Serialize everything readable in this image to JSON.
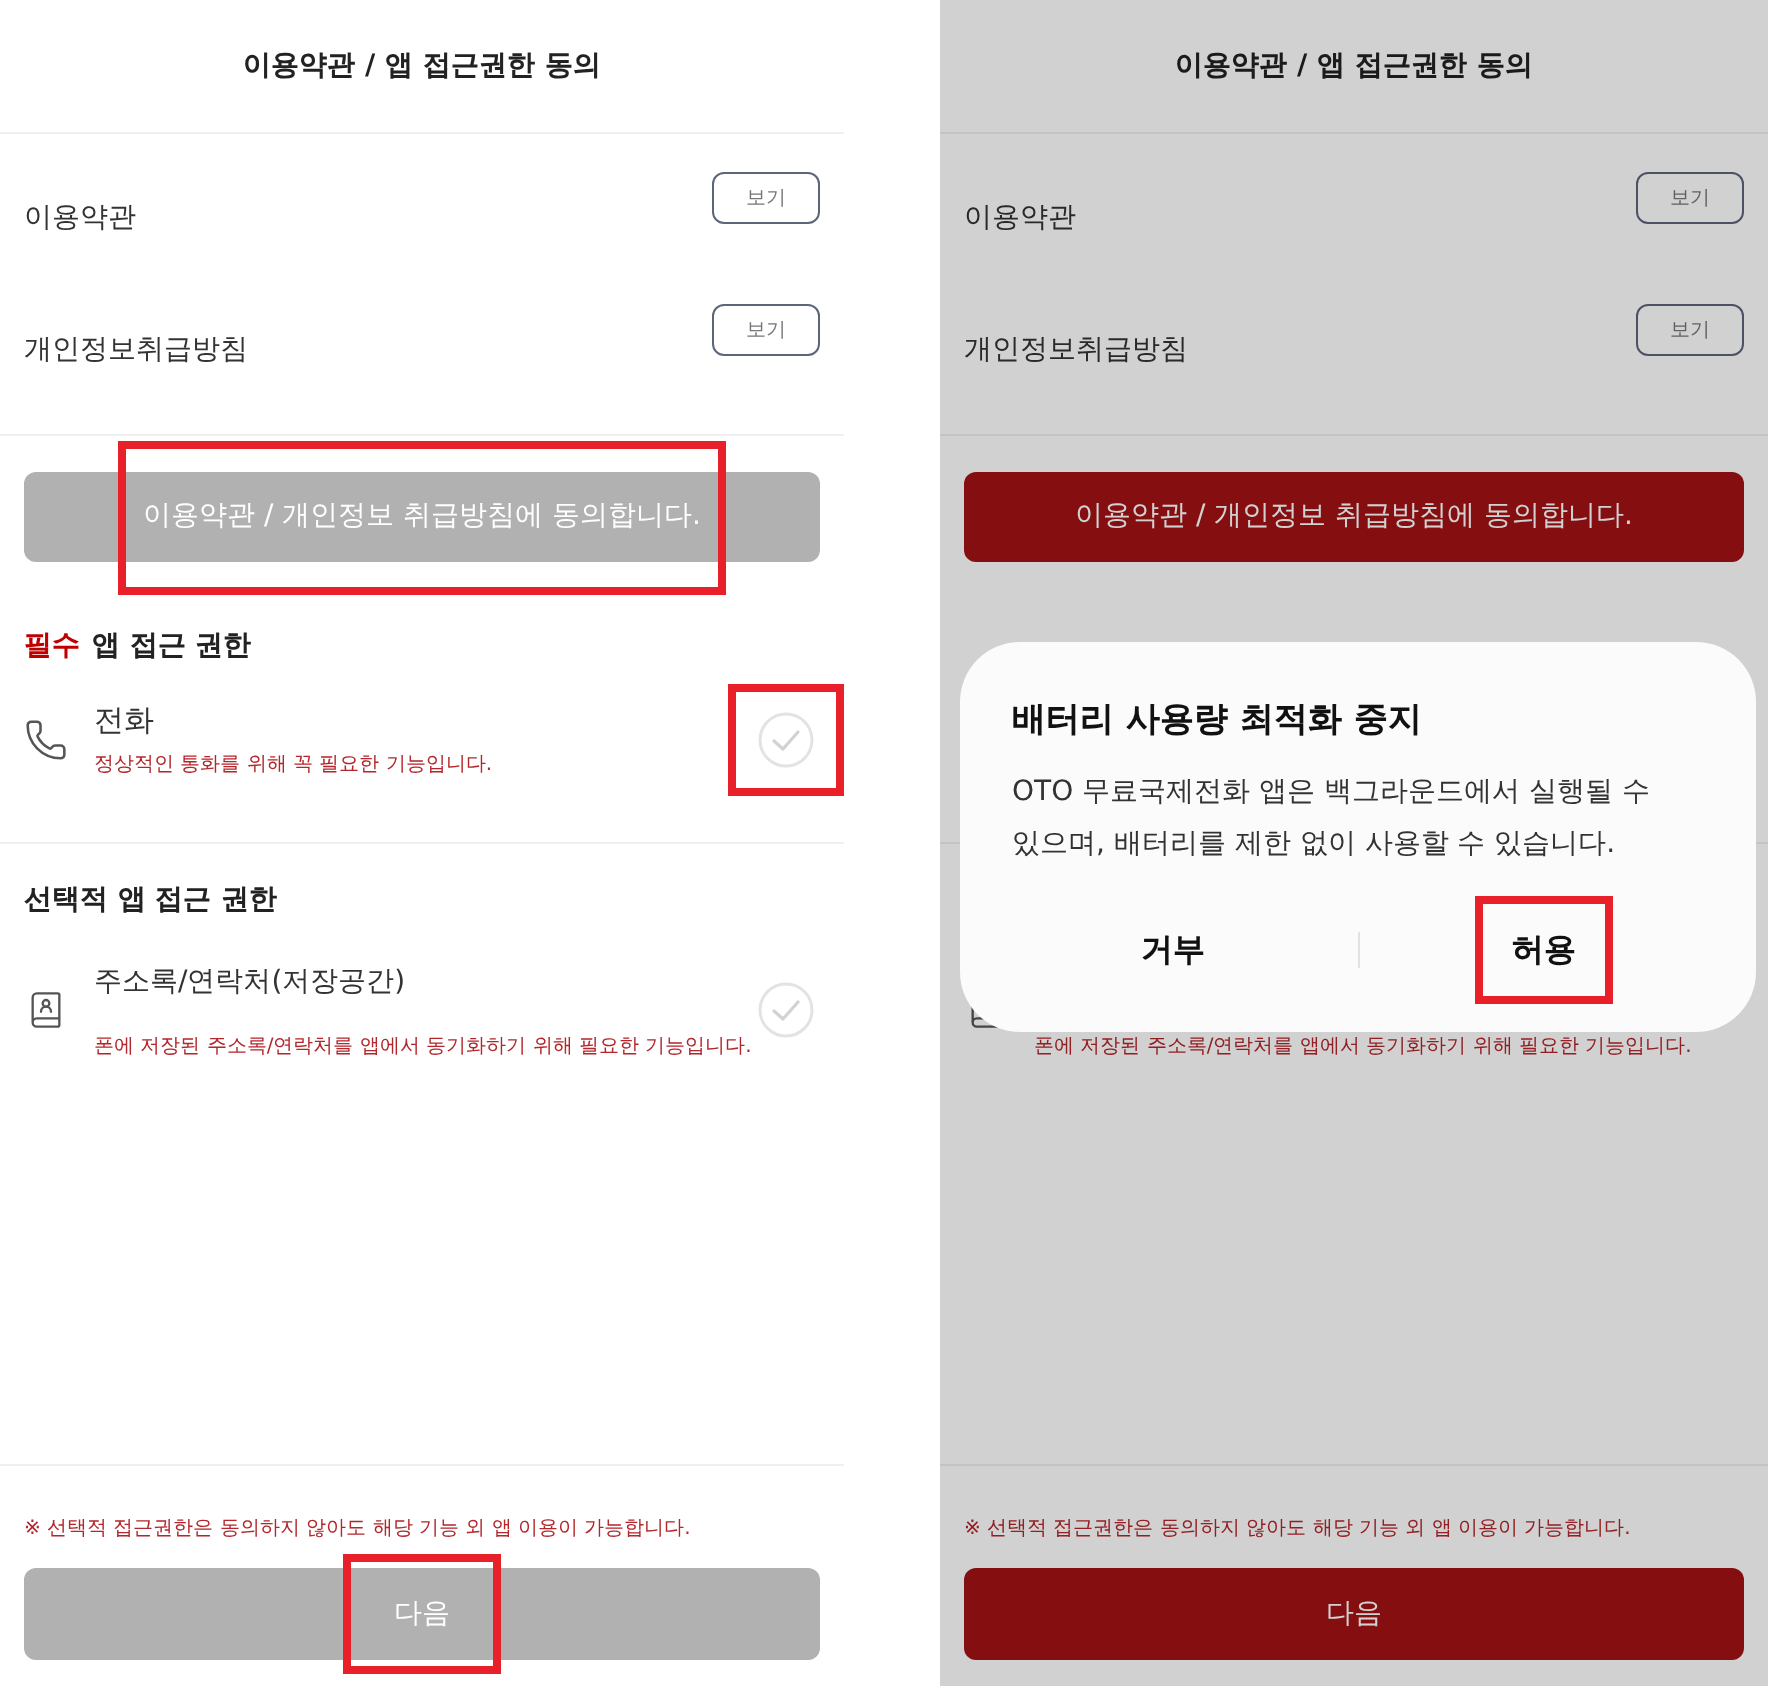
{
  "screens": [
    {
      "title": "이용약관 / 앱 접근권한 동의",
      "documents": [
        {
          "label": "이용약관",
          "view_button": "보기"
        },
        {
          "label": "개인정보취급방침",
          "view_button": "보기"
        }
      ],
      "agree_button": {
        "label": "이용약관 / 개인정보 취급방침에 동의합니다.",
        "enabled": false,
        "highlighted": true
      },
      "required_permissions": {
        "tag": "필수",
        "title": "앱 접근 권한",
        "items": [
          {
            "kind": "phone",
            "name": "전화",
            "description": "정상적인 통화를 위해 꼭 필요한 기능입니다.",
            "checked": false,
            "highlighted": true
          }
        ]
      },
      "optional_permissions": {
        "title": "선택적 앱 접근 권한",
        "items": [
          {
            "kind": "contacts",
            "name": "주소록/연락처(저장공간)",
            "description": "폰에 저장된 주소록/연락처를 앱에서 동기화하기 위해 필요한 기능입니다.",
            "checked": false,
            "highlighted": false
          }
        ]
      },
      "note": "※ 선택적 접근권한은 동의하지 않아도 해당 기능 외 앱 이용이 가능합니다.",
      "next_button": {
        "label": "다음",
        "enabled": false,
        "highlighted": true
      }
    },
    {
      "title": "이용약관 / 앱 접근권한 동의",
      "documents": [
        {
          "label": "이용약관",
          "view_button": "보기"
        },
        {
          "label": "개인정보취급방침",
          "view_button": "보기"
        }
      ],
      "agree_button": {
        "label": "이용약관 / 개인정보 취급방침에 동의합니다.",
        "enabled": true,
        "highlighted": false
      },
      "optional_permissions": {
        "items": [
          {
            "kind": "contacts",
            "description": "폰에 저장된 주소록/연락처를 앱에서 동기화하기 위해 필요한 기능입니다."
          }
        ]
      },
      "note": "※ 선택적 접근권한은 동의하지 않아도 해당 기능 외 앱 이용이 가능합니다.",
      "next_button": {
        "label": "다음",
        "enabled": true,
        "highlighted": false
      },
      "dialog": {
        "title": "배터리 사용량 최적화 중지",
        "message": "OTO 무료국제전화 앱은 백그라운드에서 실행될 수 있으며, 배터리를 제한 없이 사용할 수 있습니다.",
        "buttons": [
          {
            "label": "거부",
            "highlighted": false
          },
          {
            "label": "허용",
            "highlighted": true
          }
        ]
      }
    }
  ]
}
